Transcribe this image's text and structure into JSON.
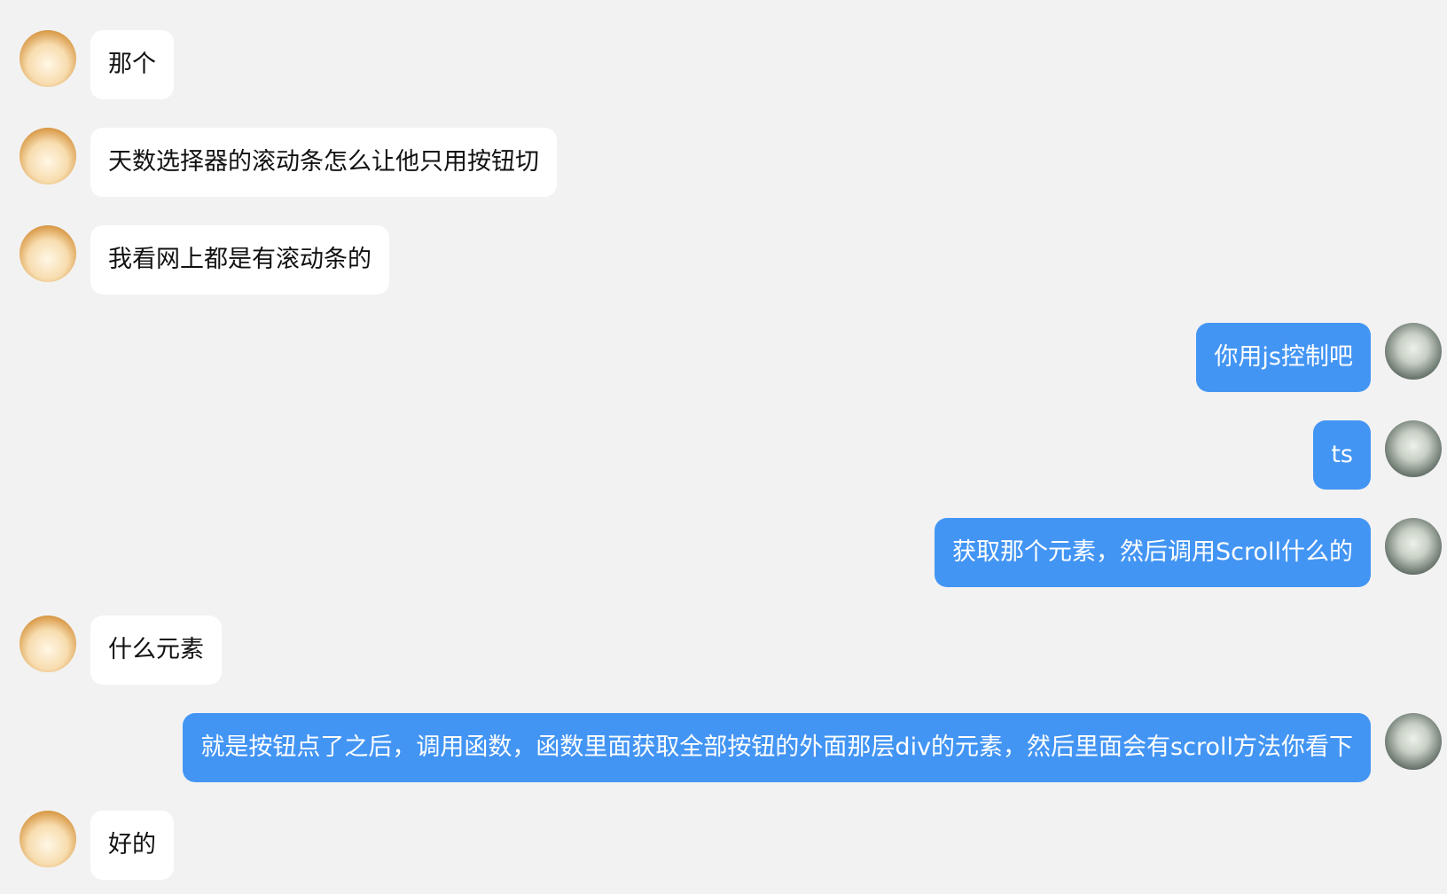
{
  "messages": [
    {
      "side": "left",
      "avatar": "cat-avatar",
      "text": "那个"
    },
    {
      "side": "left",
      "avatar": "cat-avatar",
      "text": "天数选择器的滚动条怎么让他只用按钮切"
    },
    {
      "side": "left",
      "avatar": "cat-avatar",
      "text": "我看网上都是有滚动条的"
    },
    {
      "side": "right",
      "avatar": "girl-avatar",
      "text": "你用js控制吧"
    },
    {
      "side": "right",
      "avatar": "girl-avatar",
      "text": "ts"
    },
    {
      "side": "right",
      "avatar": "girl-avatar",
      "text": "获取那个元素，然后调用Scroll什么的"
    },
    {
      "side": "left",
      "avatar": "cat-avatar",
      "text": "什么元素"
    },
    {
      "side": "right",
      "avatar": "girl-avatar",
      "text": "就是按钮点了之后，调用函数，函数里面获取全部按钮的外面那层div的元素，然后里面会有scroll方法你看下"
    },
    {
      "side": "left",
      "avatar": "cat-avatar",
      "text": "好的"
    }
  ],
  "colors": {
    "background": "#f2f2f2",
    "incoming_bubble": "#ffffff",
    "outgoing_bubble": "#4395f4"
  }
}
